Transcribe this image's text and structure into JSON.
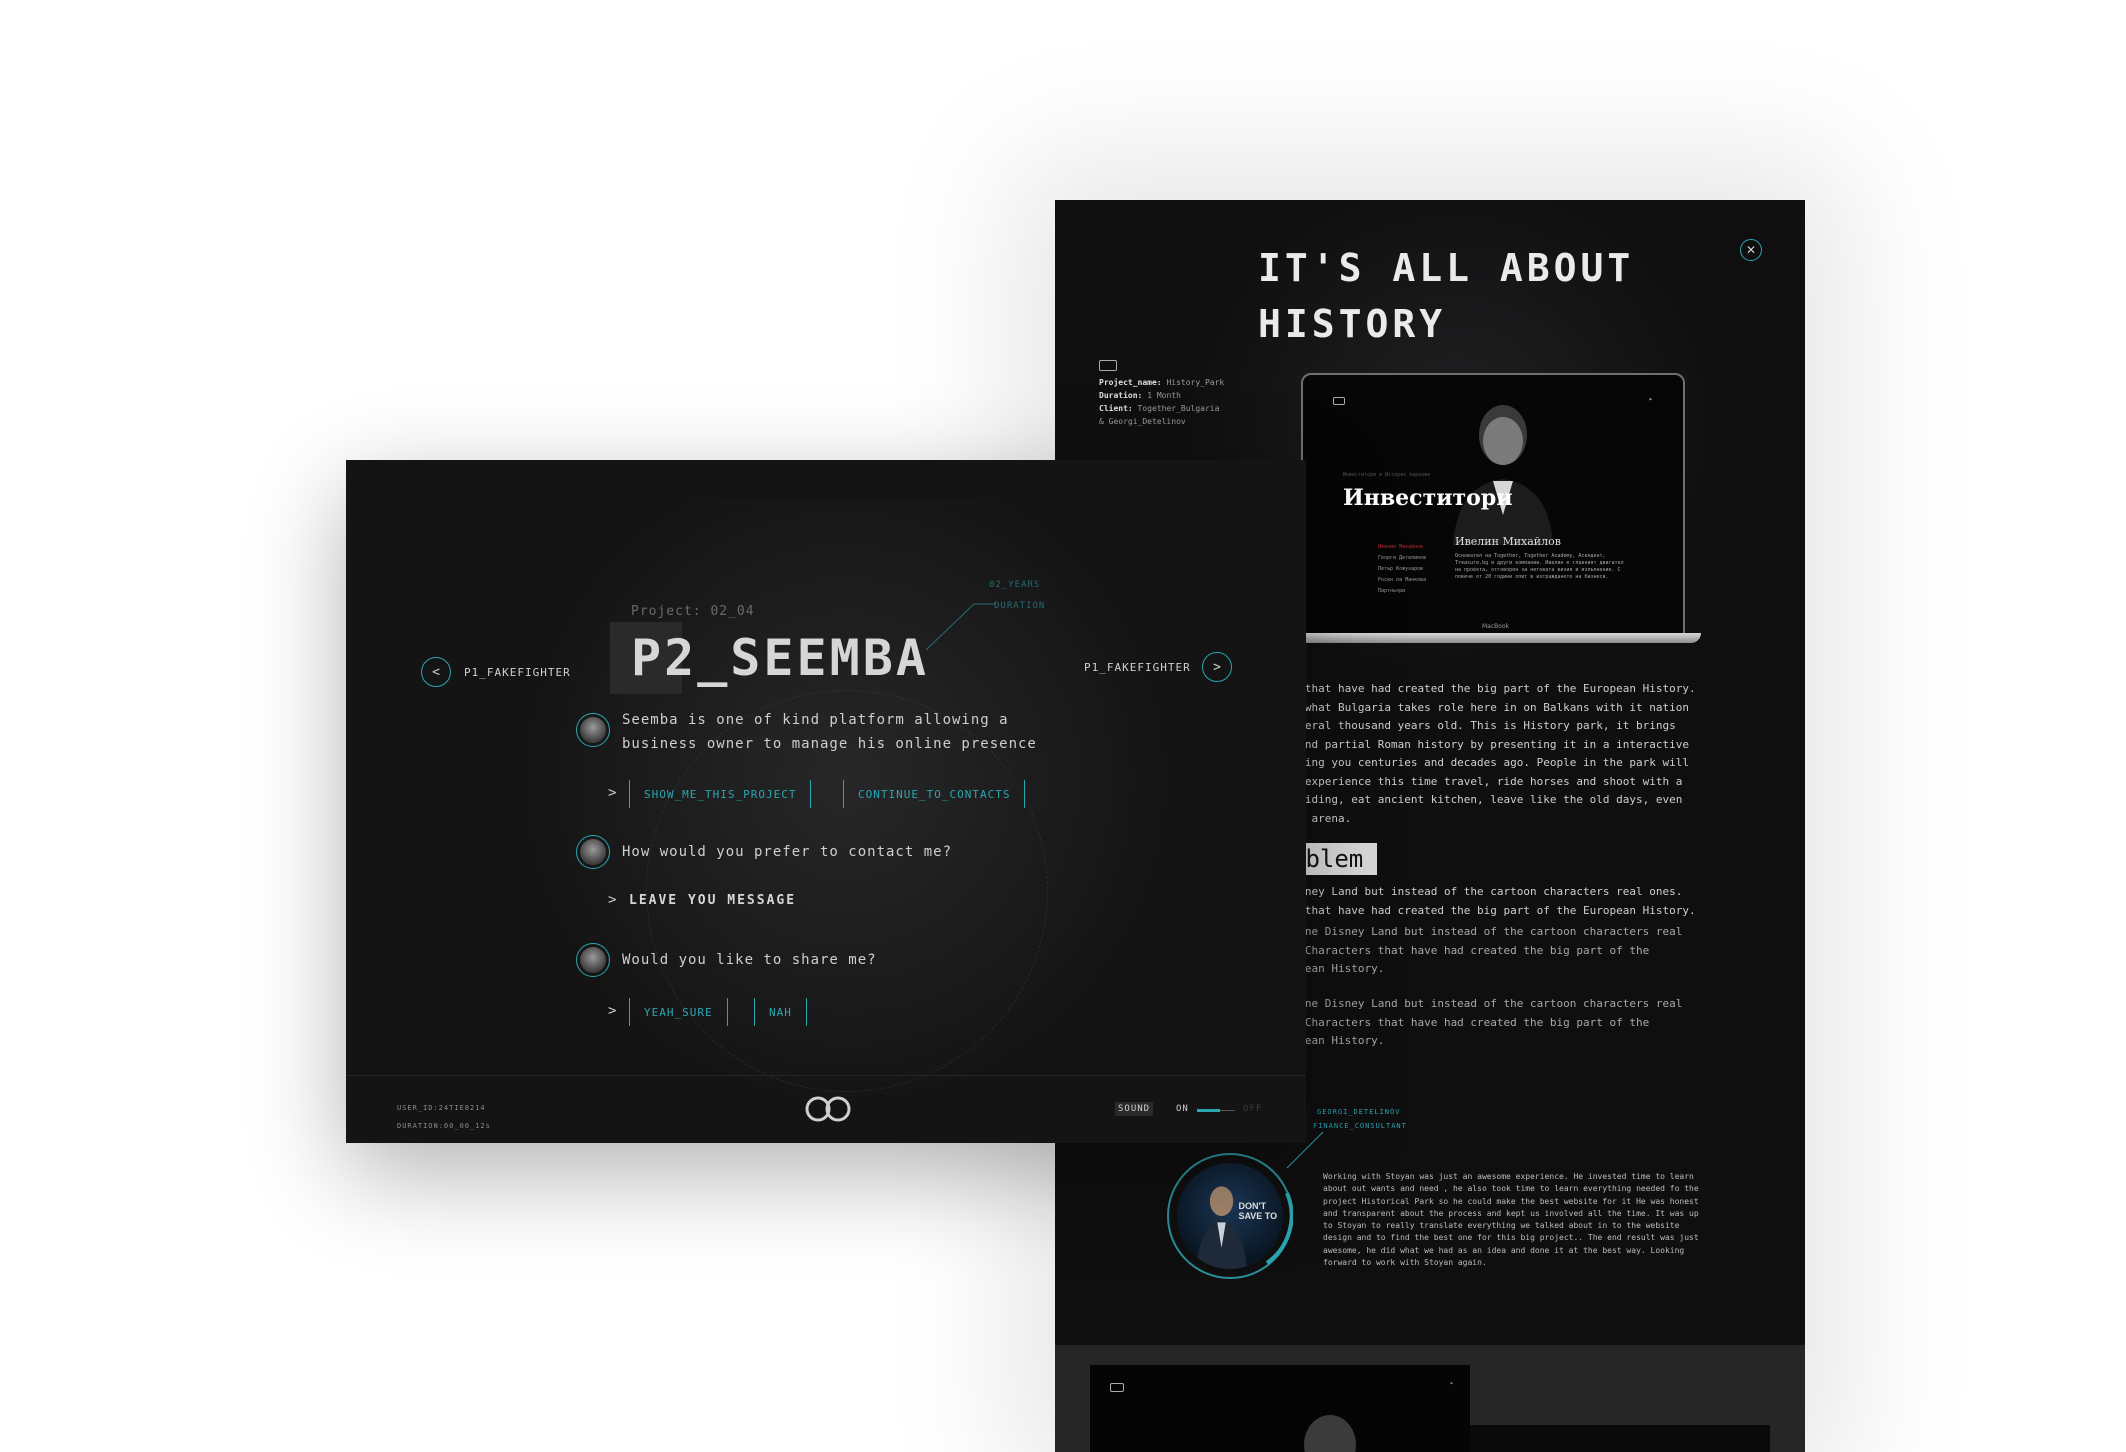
{
  "history_panel": {
    "title": "IT'S ALL ABOUT\nHISTORY",
    "close_icon": "close-icon",
    "meta": {
      "project_label": "Project_name:",
      "project_value": "History_Park",
      "duration_label": "Duration:",
      "duration_value": "1 Month",
      "client_label": "Client:",
      "client_value": "Together_Bulgaria\n& Georgi_Detelinov"
    },
    "laptop": {
      "kicker": "Инвеститори в Историк паркове",
      "heading": "Инвеститори",
      "person_name": "Ивелин Михайлов",
      "bio": "Основател на Together, Together Academy, Асендент, Treasure.bg и други компании. Ивелин е главният двигател на проекта, отговорен за неговата визия и изпълнение. С повече от 20 години опит в изграждането на бизнеси.",
      "menu": [
        "Ивелин Михайлов",
        "Георги Детелинов",
        "Петър Кожухаров",
        "Росен ла Манкова",
        "Партньори"
      ],
      "brand": "MacBook"
    },
    "paragraph1": "rs that have had created the big part of the European History.\nss what Bulgaria takes role here in on Balkans with it nation\n several thousand years old. This is History park, it brings\nn and partial Roman history by presenting it in a interactive\n taking you centuries and decades ago. People in the park will\n to experience this time travel, ride horses and shoot with a\ne riding, eat ancient kitchen, leave like the old days, even\n the arena.",
    "problem_heading": "oblem",
    "paragraph2": " Disney Land but instead of the cartoon characters real ones.\nrs that have had created the big part of the European History.",
    "paragraph3": "agine Disney Land but instead of the cartoon characters real\ns. Characters that have had created the big part of the\nropean History.",
    "paragraph4": "agine Disney Land but instead of the cartoon characters real\ns. Characters that have had created the big part of the\nropean History.",
    "testimonial": {
      "name_tag": "GEORGI_DETELINOV",
      "role_tag": "FINANCE_CONSULTANT",
      "poster_text": "DON'T SAVE TO",
      "quote": "Working with Stoyan was just an awesome experience. He invested time to learn about out wants and need , he also took time to learn everything needed fo the project Historical Park so he could make the best website for it He was honest and transparent about the process and kept us involved all the time. It was up to Stoyan to really translate everything we talked about in to the website design and to find the best one for this big project.. The end result was just awesome, he did what we had as an idea and done it at the best way. Looking forward to work with Stoyan again."
    }
  },
  "seemba_panel": {
    "project_label": "Project: 02_04",
    "title": "P2_SEEMBA",
    "years_tag": "02_YEARS",
    "duration_tag": "DURATION",
    "prev_label": "P1_FAKEFIGHTER",
    "next_label": "P1_FAKEFIGHTER",
    "chat": {
      "msg1": "Seemba is one of kind platform allowing a\nbusiness owner to manage his online presence",
      "option_show": "SHOW_ME_THIS_PROJECT",
      "option_contacts": "CONTINUE_TO_CONTACTS",
      "msg2": "How would you prefer to contact me?",
      "leave_message": "LEAVE YOU MESSAGE",
      "msg3": "Would you like to share me?",
      "option_yes": "YEAH_SURE",
      "option_no": "NAH",
      "arrow": ">"
    },
    "footer": {
      "user_id": "USER_ID:24TIE8214",
      "duration": "DURATION:00_00_12s",
      "sound_label": "SOUND",
      "on_label": "ON",
      "off_label": "OFF",
      "sound_level": 0.6
    },
    "colors": {
      "accent": "#2aa6b1",
      "panel": "#141414"
    }
  }
}
